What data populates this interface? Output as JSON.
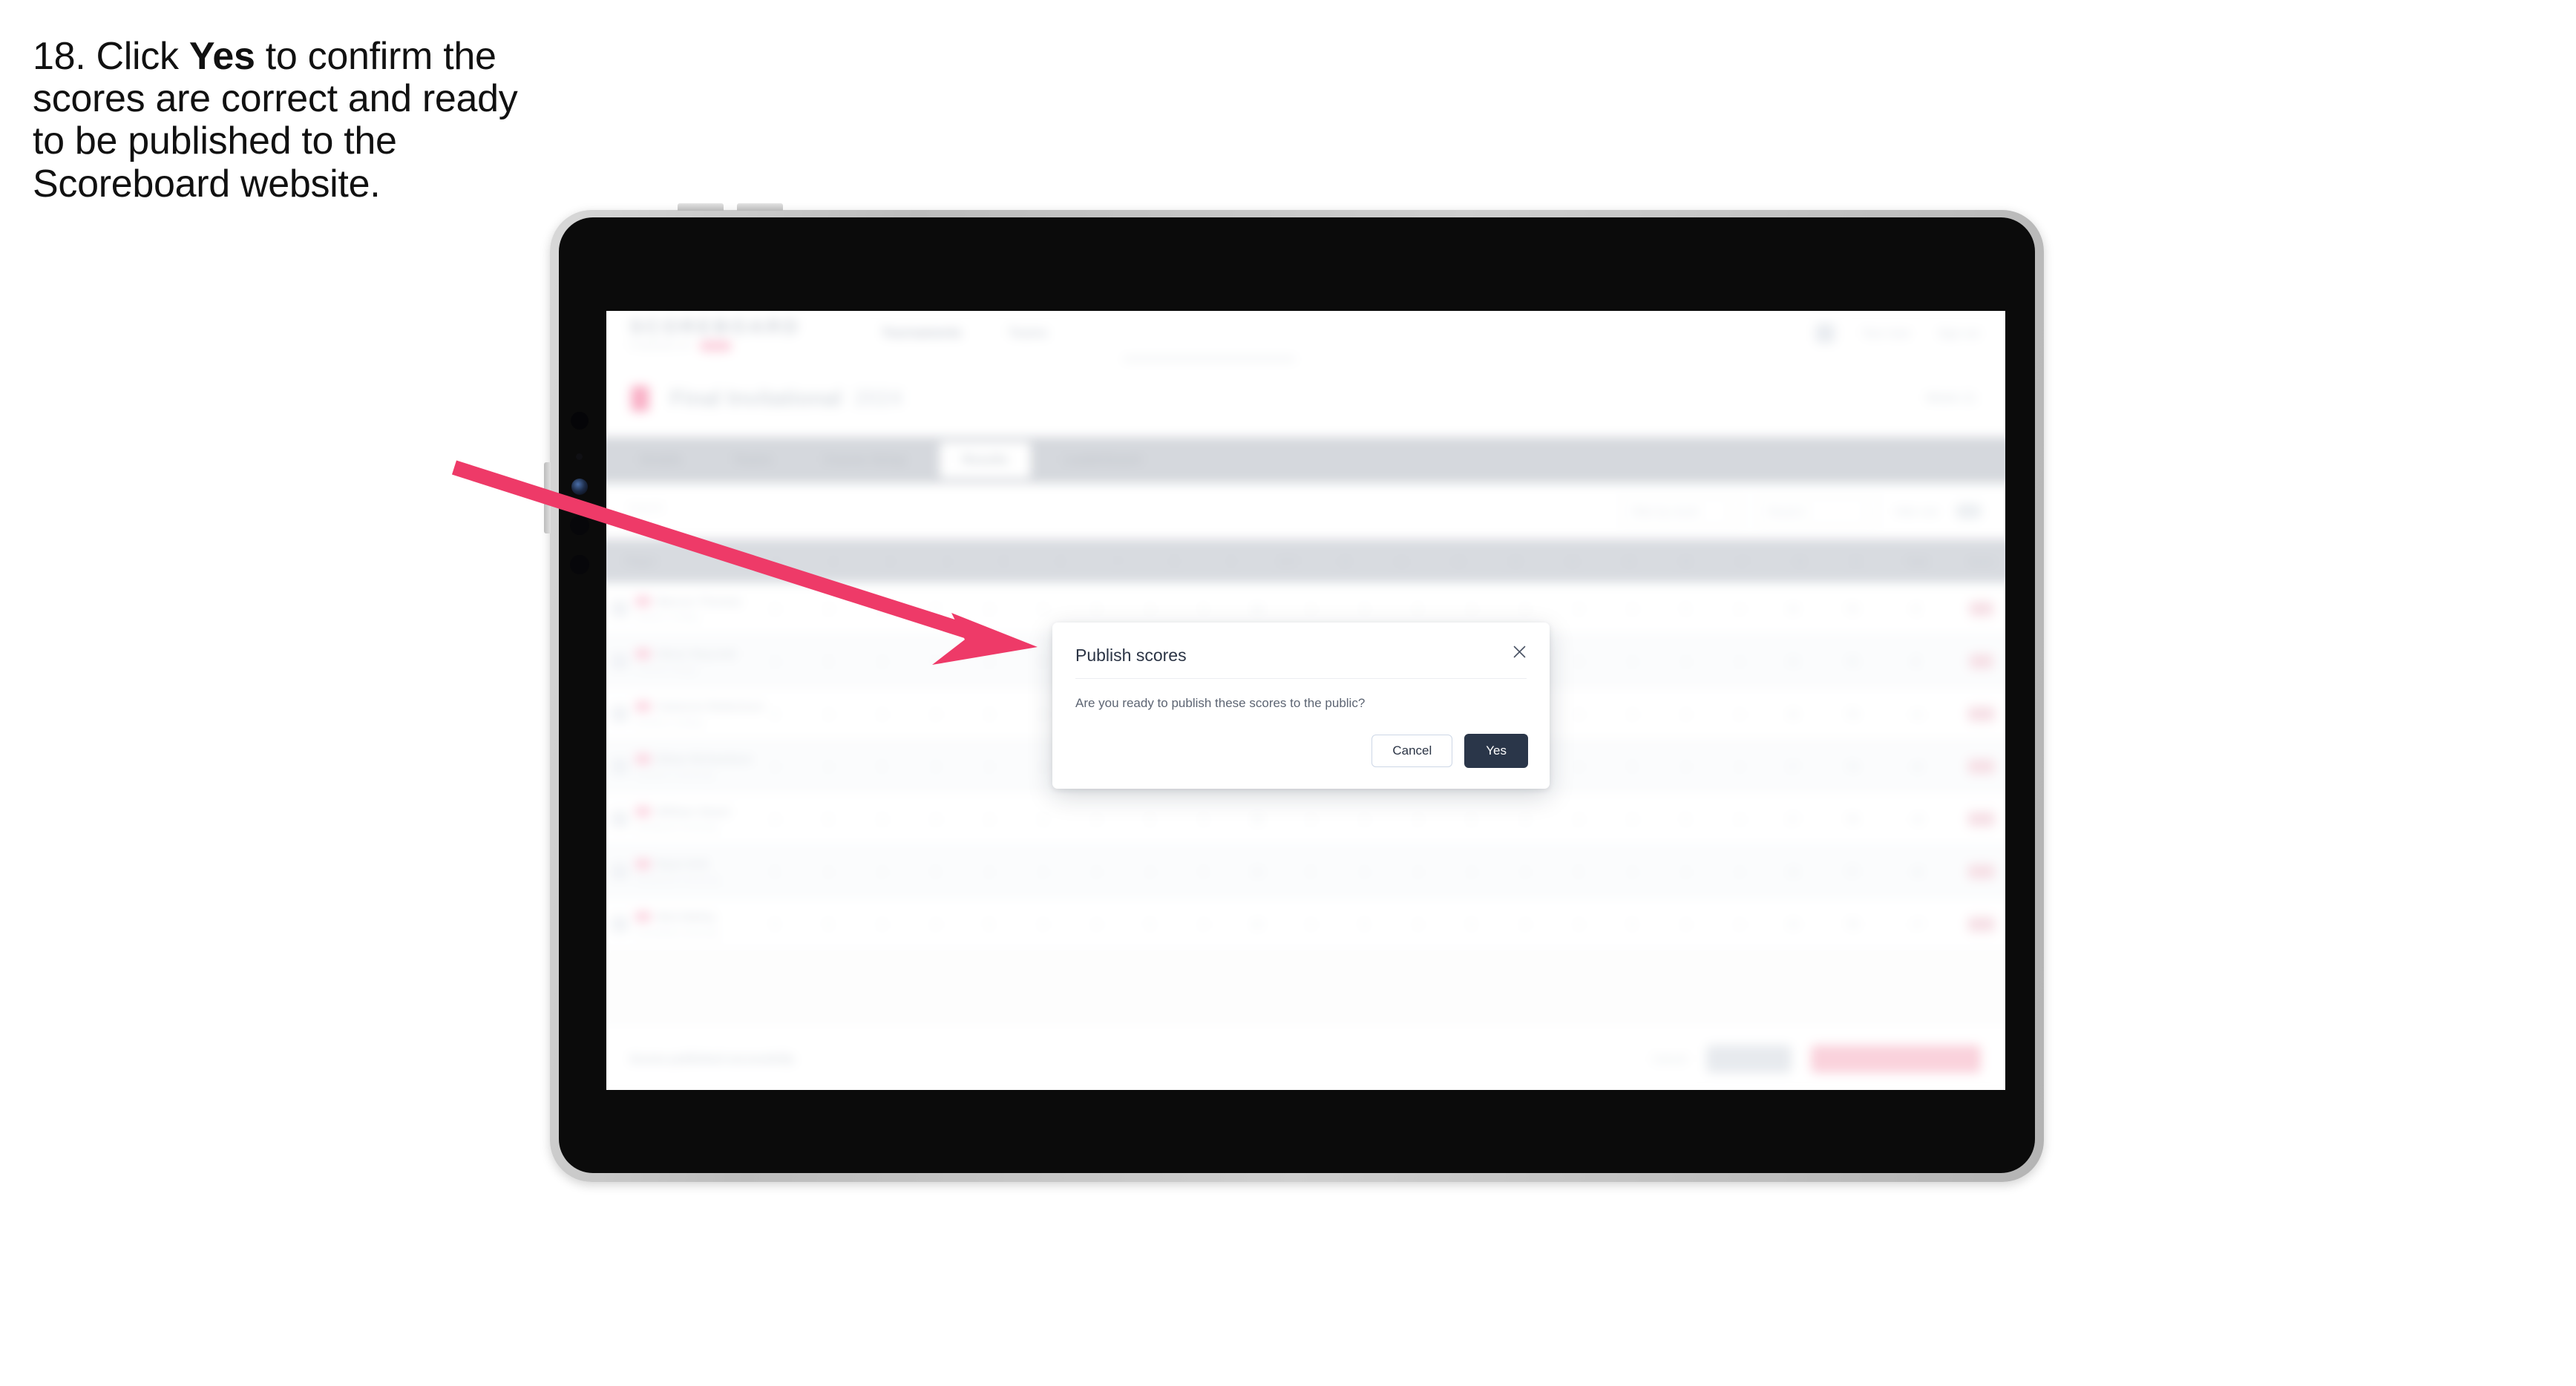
{
  "instruction": {
    "step_number": "18.",
    "pre": " Click ",
    "emphasis": "Yes",
    "post": " to confirm the scores are correct and ready to be published to the Scoreboard website."
  },
  "colors": {
    "arrow": "#EE3A68",
    "yes_button_bg": "#2A3649",
    "frame_silver": "#C6C6C6",
    "bezel_black": "#0B0B0B"
  },
  "tablet": {
    "volume_up": "volume-up-button",
    "volume_down": "volume-down-button",
    "power": "power-button",
    "front_camera": "front-camera"
  },
  "app": {
    "header": {
      "logo": "SCOREBOARD",
      "logo_sub": "POWERED BY",
      "logo_pill": "LIVE",
      "nav": [
        {
          "label": "Tournaments"
        },
        {
          "label": "Teams"
        }
      ],
      "user_name": "Tour User",
      "sign_out": "Sign out",
      "avatar": "user-avatar"
    },
    "event": {
      "flag": "event-flag",
      "title": "Final Invitational",
      "year": "2024",
      "right_label": "Week 21"
    },
    "tabs": [
      {
        "label": "Details",
        "active": false
      },
      {
        "label": "Teams",
        "active": false
      },
      {
        "label": "Course Setup",
        "active": false
      },
      {
        "label": "Results",
        "active": true
      },
      {
        "label": "Leaderboard",
        "active": false
      }
    ],
    "toolbar": {
      "search_placeholder": "Search",
      "filters": [
        {
          "label": "Filter by round",
          "chevron": "▾"
        },
        {
          "label": "Round 1",
          "chevron": "▾"
        }
      ],
      "toggle_label": "Hide cuts",
      "toggle": "hide-cuts-toggle"
    },
    "table": {
      "player_column": "Player",
      "hole_columns": [
        "1",
        "2",
        "3",
        "4",
        "5",
        "6",
        "7",
        "8",
        "9",
        "OUT",
        "10",
        "11",
        "12",
        "13",
        "14",
        "15",
        "16",
        "17",
        "18",
        "IN"
      ],
      "wide_columns": [
        "Total",
        "Score"
      ],
      "rows": [
        {
          "rank": "1",
          "name": "Marcus Thomas",
          "sub": "Eastern College",
          "holes": [
            "4",
            "4",
            "3",
            "5",
            "4",
            "4",
            "3",
            "4",
            "5",
            "36",
            "4",
            "3",
            "5",
            "4",
            "4",
            "3",
            "4",
            "5",
            "4",
            "36"
          ],
          "total": "72",
          "par": "E",
          "score_pill": "-2"
        },
        {
          "rank": "2",
          "name": "Oliver Reynold",
          "sub": "Central College",
          "holes": [
            "4",
            "5",
            "3",
            "4",
            "4",
            "5",
            "3",
            "4",
            "4",
            "36",
            "5",
            "3",
            "4",
            "4",
            "5",
            "3",
            "4",
            "4",
            "4",
            "36"
          ],
          "total": "72",
          "par": "E",
          "score_pill": "-1"
        },
        {
          "rank": "3",
          "name": "Cameron Robertson",
          "sub": "Northern College",
          "holes": [
            "5",
            "4",
            "4",
            "4",
            "3",
            "4",
            "4",
            "5",
            "4",
            "37",
            "4",
            "4",
            "4",
            "3",
            "5",
            "4",
            "4",
            "4",
            "4",
            "36"
          ],
          "total": "73",
          "par": "+1",
          "score_pill": "+1"
        },
        {
          "rank": "4",
          "name": "Ethan Richardson",
          "sub": "Southern University",
          "holes": [
            "4",
            "4",
            "5",
            "3",
            "4",
            "4",
            "5",
            "4",
            "4",
            "37",
            "4",
            "5",
            "3",
            "4",
            "4",
            "4",
            "5",
            "4",
            "4",
            "37"
          ],
          "total": "74",
          "par": "+2",
          "score_pill": "+2"
        },
        {
          "rank": "5",
          "name": "William Steart",
          "sub": "Northwest University",
          "holes": [
            "4",
            "5",
            "4",
            "4",
            "4",
            "3",
            "4",
            "5",
            "5",
            "38",
            "4",
            "4",
            "4",
            "5",
            "3",
            "4",
            "4",
            "5",
            "4",
            "37"
          ],
          "total": "75",
          "par": "+3",
          "score_pill": "+3"
        },
        {
          "rank": "6",
          "name": "Ryan Kirk",
          "sub": "Westbrook University",
          "holes": [
            "5",
            "4",
            "4",
            "5",
            "4",
            "4",
            "4",
            "4",
            "5",
            "39",
            "5",
            "4",
            "4",
            "4",
            "4",
            "5",
            "4",
            "4",
            "4",
            "38"
          ],
          "total": "77",
          "par": "+5",
          "score_pill": "+5"
        },
        {
          "rank": "7",
          "name": "Nick Bailey",
          "sub": "Greenfield University",
          "holes": [
            "5",
            "5",
            "4",
            "4",
            "5",
            "4",
            "4",
            "5",
            "4",
            "40",
            "4",
            "5",
            "4",
            "5",
            "4",
            "4",
            "5",
            "4",
            "4",
            "39"
          ],
          "total": "79",
          "par": "+7",
          "score_pill": "+7"
        }
      ]
    },
    "footer": {
      "note": "Scores published successfully",
      "link": "Cancel",
      "secondary_button": "Save all",
      "primary_button": "Publish scores to public"
    }
  },
  "modal": {
    "title": "Publish scores",
    "body": "Are you ready to publish these scores to the public?",
    "cancel_label": "Cancel",
    "confirm_label": "Yes",
    "close_icon": "×"
  }
}
